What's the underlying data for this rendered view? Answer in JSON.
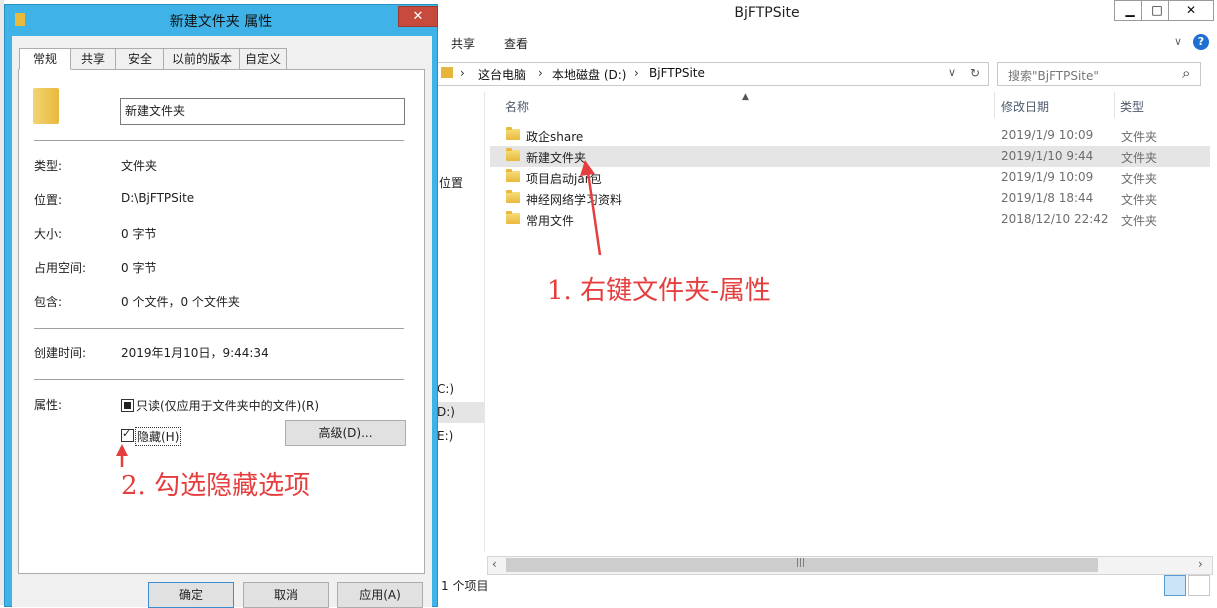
{
  "explorer": {
    "title": "BjFTPSite",
    "controls": {
      "minimize": "▁",
      "maximize": "□",
      "close": "✕"
    },
    "ribbon": {
      "tabs": [
        "共享",
        "查看"
      ],
      "expand": "∨",
      "help": "?"
    },
    "address": {
      "crumbs": [
        "这台电脑",
        "本地磁盘 (D:)",
        "BjFTPSite"
      ],
      "sep": "›",
      "dropdown": "∨",
      "refresh": "↻"
    },
    "search": {
      "placeholder": "搜索\"BjFTPSite\"",
      "icon": "⌕"
    },
    "nav": {
      "items": [
        "位置",
        "C:)",
        "D:)",
        "E:)"
      ]
    },
    "columns": {
      "name": "名称",
      "modified": "修改日期",
      "type": "类型"
    },
    "files": [
      {
        "name": "政企share",
        "modified": "2019/1/9 10:09",
        "type": "文件夹"
      },
      {
        "name": "新建文件夹",
        "modified": "2019/1/10 9:44",
        "type": "文件夹"
      },
      {
        "name": "项目启动jar包",
        "modified": "2019/1/9 10:09",
        "type": "文件夹"
      },
      {
        "name": "神经网络学习资料",
        "modified": "2019/1/8 18:44",
        "type": "文件夹"
      },
      {
        "name": "常用文件",
        "modified": "2018/12/10 22:42",
        "type": "文件夹"
      }
    ],
    "status": "1 个项目",
    "scroll": {
      "left": "‹",
      "right": "›",
      "grip": "|||"
    }
  },
  "dialog": {
    "title": "新建文件夹 属性",
    "close": "✕",
    "tabs": [
      "常规",
      "共享",
      "安全",
      "以前的版本",
      "自定义"
    ],
    "folder_name": "新建文件夹",
    "fields": {
      "type": {
        "label": "类型:",
        "value": "文件夹"
      },
      "location": {
        "label": "位置:",
        "value": "D:\\BjFTPSite"
      },
      "size": {
        "label": "大小:",
        "value": "0 字节"
      },
      "disk_size": {
        "label": "占用空间:",
        "value": "0 字节"
      },
      "contains": {
        "label": "包含:",
        "value": "0 个文件，0 个文件夹"
      },
      "created": {
        "label": "创建时间:",
        "value": "2019年1月10日，9:44:34"
      }
    },
    "attributes": {
      "label": "属性:",
      "readonly": "只读(仅应用于文件夹中的文件)(R)",
      "hidden": "隐藏(H)",
      "advanced": "高级(D)..."
    },
    "buttons": {
      "ok": "确定",
      "cancel": "取消",
      "apply": "应用(A)"
    }
  },
  "annotations": {
    "step1": "1. 右键文件夹-属性",
    "step2": "2. 勾选隐藏选项"
  },
  "colors": {
    "annotation": "#e53e3e",
    "dialog_frame": "#3fb3e8",
    "selected_row": "#e5e5e5"
  }
}
